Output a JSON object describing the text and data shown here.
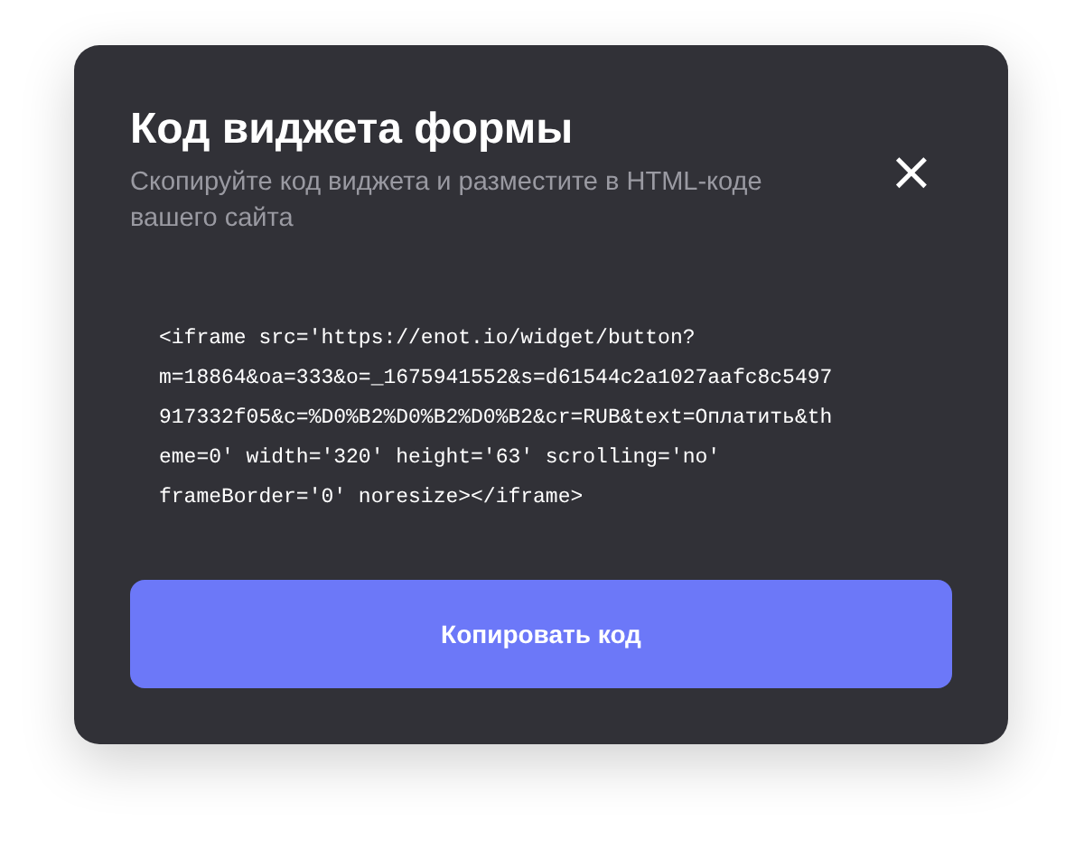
{
  "dialog": {
    "title": "Код виджета формы",
    "subtitle": "Скопируйте код виджета и разместите в HTML-коде вашего сайта",
    "close": "×"
  },
  "code_lines": [
    "<iframe src='https://enot.io/widget/button?",
    "m=18864&oa=333&o=_1675941552&s=d61544c2a1027aafc8c5497",
    "917332f05&c=%D0%B2%D0%B2%D0%B2&cr=RUB&text=Оплатить&th",
    "eme=0' width='320' height='63' scrolling='no'",
    "frameBorder='0' noresize></iframe>"
  ],
  "copy_button": "Копировать код"
}
